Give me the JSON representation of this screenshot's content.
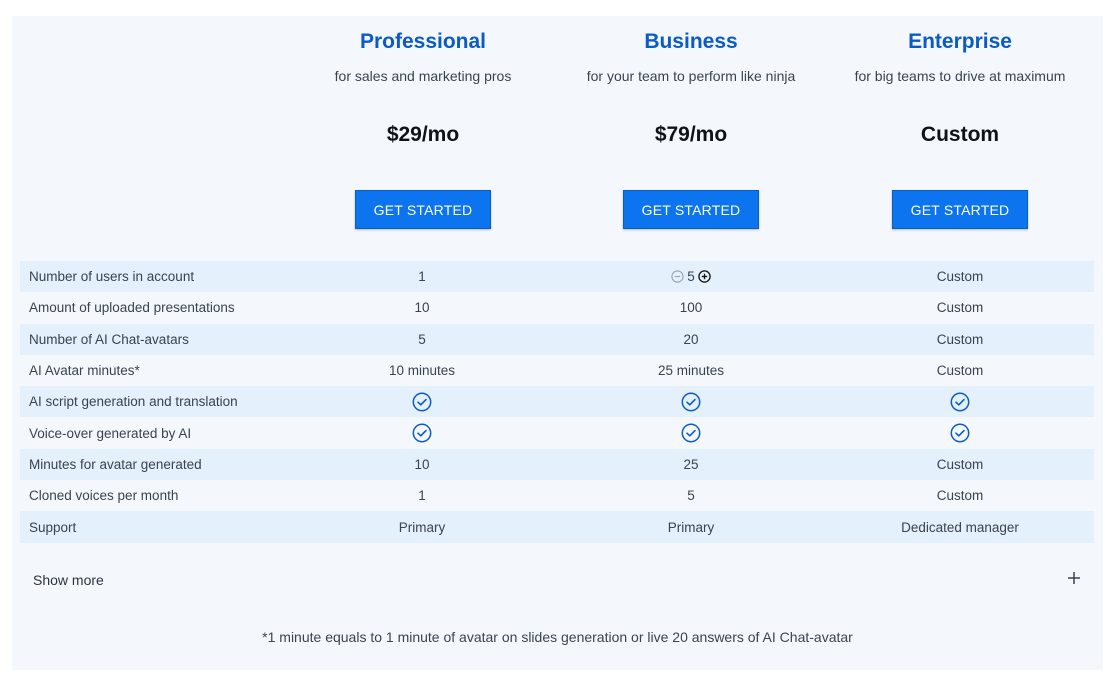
{
  "plans": [
    {
      "name": "Professional",
      "subtitle": "for sales and marketing pros",
      "price": "$29/mo",
      "cta": "GET STARTED"
    },
    {
      "name": "Business",
      "subtitle": "for your team to perform like ninja",
      "price": "$79/mo",
      "cta": "GET STARTED"
    },
    {
      "name": "Enterprise",
      "subtitle": "for big teams to drive at maximum",
      "price": "Custom",
      "cta": "GET STARTED"
    }
  ],
  "rows": [
    {
      "label": "Number of users in account",
      "values": [
        "1",
        "5",
        "Custom"
      ]
    },
    {
      "label": "Amount of uploaded presentations",
      "values": [
        "10",
        "100",
        "Custom"
      ]
    },
    {
      "label": "Number of AI Chat-avatars",
      "values": [
        "5",
        "20",
        "Custom"
      ]
    },
    {
      "label": "AI Avatar minutes*",
      "values": [
        "10 minutes",
        "25 minutes",
        "Custom"
      ]
    },
    {
      "label": "AI script generation and translation",
      "values": [
        "check",
        "check",
        "check"
      ]
    },
    {
      "label": "Voice-over generated by AI",
      "values": [
        "check",
        "check",
        "check"
      ]
    },
    {
      "label": "Minutes for avatar generated",
      "values": [
        "10",
        "25",
        "Custom"
      ]
    },
    {
      "label": "Cloned voices per month",
      "values": [
        "1",
        "5",
        "Custom"
      ]
    },
    {
      "label": "Support",
      "values": [
        "Primary",
        "Primary",
        "Dedicated manager"
      ]
    }
  ],
  "show_more": "Show more",
  "footnote": "*1 minute equals to 1 minute of avatar on slides generation or live 20 answers of AI Chat-avatar",
  "colors": {
    "accent": "#0b74ee",
    "heading": "#0a5bc6",
    "row_alt": "#e4f0fc"
  },
  "icons": {
    "check": "check-circle-icon",
    "minus": "minus-circle-icon",
    "plus": "plus-circle-icon",
    "expand": "plus-icon"
  }
}
